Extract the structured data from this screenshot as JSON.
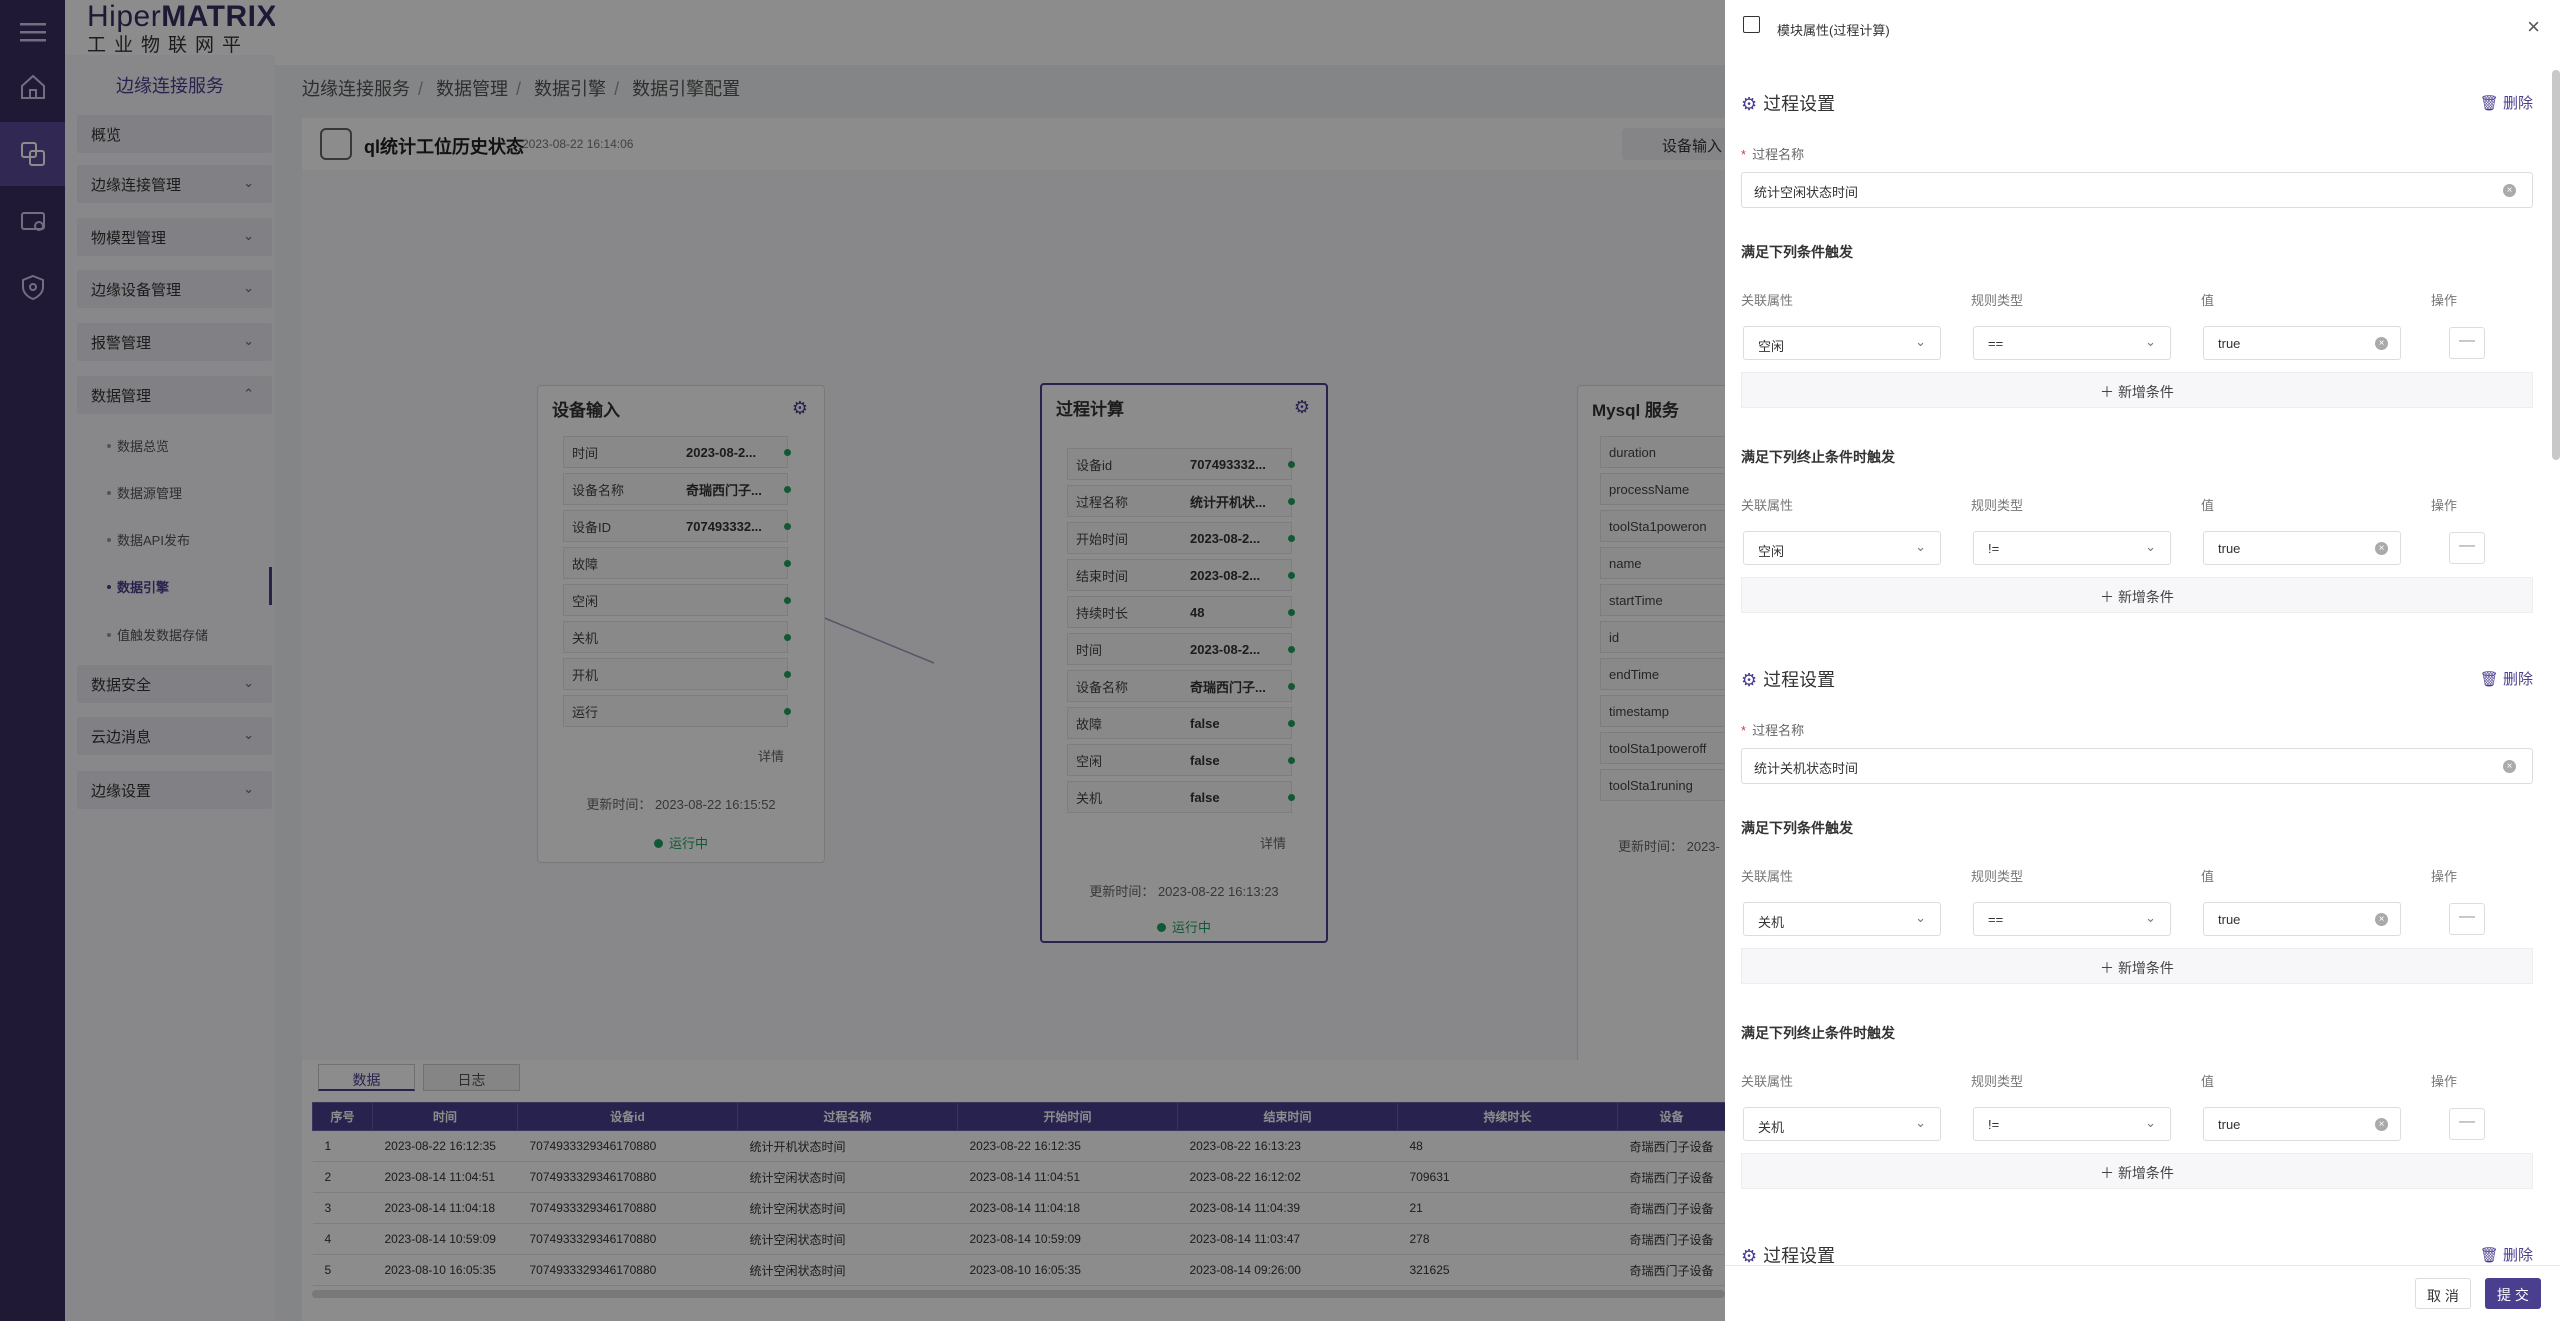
{
  "logo": {
    "brand_a": "Hiper",
    "brand_b": "MATRIX",
    "subtitle": "工业物联网平台"
  },
  "sidebar": {
    "section_title": "边缘连接服务",
    "menus": [
      {
        "label": "概览",
        "has_chevron": false
      },
      {
        "label": "边缘连接管理",
        "has_chevron": true
      },
      {
        "label": "物模型管理",
        "has_chevron": true
      },
      {
        "label": "边缘设备管理",
        "has_chevron": true
      },
      {
        "label": "报警管理",
        "has_chevron": true
      },
      {
        "label": "数据管理",
        "has_chevron": true,
        "expanded": true
      }
    ],
    "submenus": [
      "数据总览",
      "数据源管理",
      "数据API发布",
      "数据引擎",
      "值触发数据存储"
    ],
    "active_sub": "数据引擎",
    "menus_after": [
      "数据安全",
      "云边消息",
      "边缘设置"
    ]
  },
  "breadcrumb": [
    "边缘连接服务",
    "数据管理",
    "数据引擎",
    "数据引擎配置"
  ],
  "engine": {
    "title": "ql统计工位历史状态",
    "timestamp": "2023-08-22 16:14:06",
    "device_input_btn": "设备输入"
  },
  "nodes": {
    "input": {
      "title": "设备输入",
      "rows": [
        [
          "时间",
          "2023-08-2..."
        ],
        [
          "设备名称",
          "奇瑞西门子..."
        ],
        [
          "设备ID",
          "707493332..."
        ],
        [
          "故障",
          ""
        ],
        [
          "空闲",
          ""
        ],
        [
          "关机",
          ""
        ],
        [
          "开机",
          ""
        ],
        [
          "运行",
          ""
        ]
      ],
      "detail": "详情",
      "updated": "更新时间：  2023-08-22 16:15:52",
      "status": "运行中"
    },
    "process": {
      "title": "过程计算",
      "rows": [
        [
          "设备id",
          "707493332..."
        ],
        [
          "过程名称",
          "统计开机状..."
        ],
        [
          "开始时间",
          "2023-08-2..."
        ],
        [
          "结束时间",
          "2023-08-2..."
        ],
        [
          "持续时长",
          "48"
        ],
        [
          "时间",
          "2023-08-2..."
        ],
        [
          "设备名称",
          "奇瑞西门子..."
        ],
        [
          "故障",
          "false"
        ],
        [
          "空闲",
          "false"
        ],
        [
          "关机",
          "false"
        ]
      ],
      "detail": "详情",
      "updated": "更新时间：  2023-08-22 16:13:23",
      "status": "运行中"
    },
    "mysql": {
      "title": "Mysql 服务",
      "rows": [
        "duration",
        "processName",
        "toolSta1poweron",
        "name",
        "startTime",
        "id",
        "endTime",
        "timestamp",
        "toolSta1poweroff",
        "toolSta1runing"
      ],
      "updated": "更新时间：  2023-"
    }
  },
  "bottom": {
    "tabs": [
      "数据",
      "日志"
    ],
    "headers": [
      "序号",
      "时间",
      "设备id",
      "过程名称",
      "开始时间",
      "结束时间",
      "持续时长",
      "设备"
    ],
    "rows": [
      [
        "1",
        "2023-08-22 16:12:35",
        "7074933329346170880",
        "统计开机状态时间",
        "2023-08-22 16:12:35",
        "2023-08-22 16:13:23",
        "48",
        "奇瑞西门子设备"
      ],
      [
        "2",
        "2023-08-14 11:04:51",
        "7074933329346170880",
        "统计空闲状态时间",
        "2023-08-14 11:04:51",
        "2023-08-22 16:12:02",
        "709631",
        "奇瑞西门子设备"
      ],
      [
        "3",
        "2023-08-14 11:04:18",
        "7074933329346170880",
        "统计空闲状态时间",
        "2023-08-14 11:04:18",
        "2023-08-14 11:04:39",
        "21",
        "奇瑞西门子设备"
      ],
      [
        "4",
        "2023-08-14 10:59:09",
        "7074933329346170880",
        "统计空闲状态时间",
        "2023-08-14 10:59:09",
        "2023-08-14 11:03:47",
        "278",
        "奇瑞西门子设备"
      ],
      [
        "5",
        "2023-08-10 16:05:35",
        "7074933329346170880",
        "统计空闲状态时间",
        "2023-08-10 16:05:35",
        "2023-08-14 09:26:00",
        "321625",
        "奇瑞西门子设备"
      ]
    ]
  },
  "drawer": {
    "title": "模块属性(过程计算)",
    "section_title": "过程设置",
    "delete_label": "删除",
    "name_label": "过程名称",
    "trigger_title": "满足下列条件触发",
    "end_title": "满足下列终止条件时触发",
    "col_attr": "关联属性",
    "col_rule": "规则类型",
    "col_value": "值",
    "col_op": "操作",
    "add_condition": "新增条件",
    "sections": [
      {
        "name": "统计空闲状态时间",
        "trigger": {
          "attr": "空闲",
          "rule": "==",
          "value": "true"
        },
        "end": {
          "attr": "空闲",
          "rule": "!=",
          "value": "true"
        }
      },
      {
        "name": "统计关机状态时间",
        "trigger": {
          "attr": "关机",
          "rule": "==",
          "value": "true"
        },
        "end": {
          "attr": "关机",
          "rule": "!=",
          "value": "true"
        }
      }
    ],
    "cancel": "取 消",
    "submit": "提 交"
  },
  "colors": {
    "brand": "#4a3f8f",
    "rail": "#3b2f63",
    "success": "#20a060"
  }
}
